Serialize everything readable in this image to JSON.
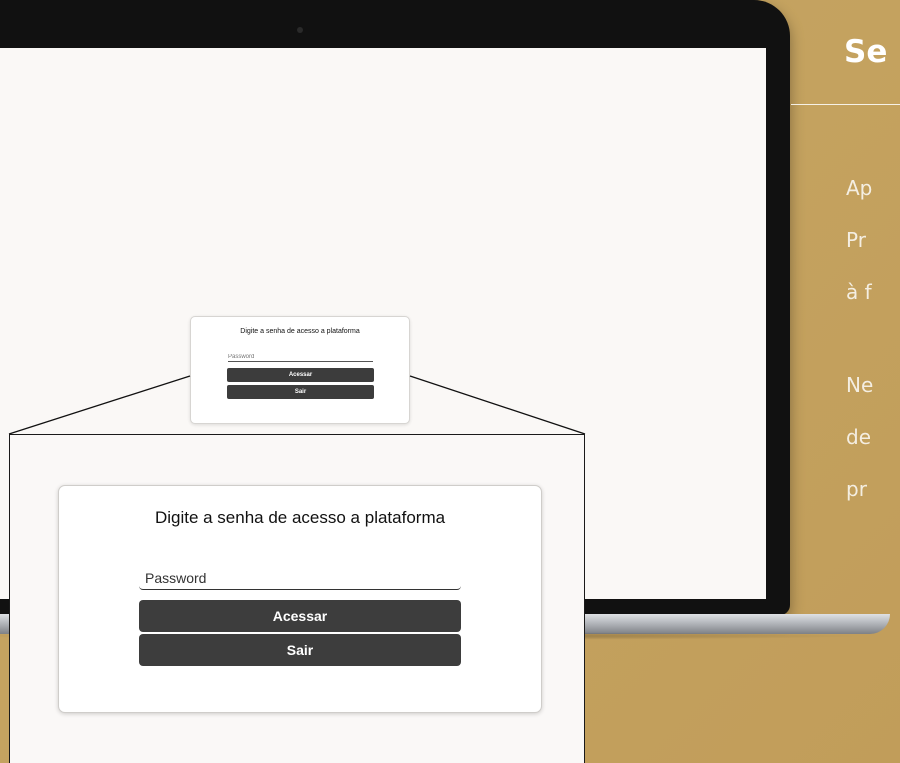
{
  "colors": {
    "background": "#c4a25f",
    "screen": "#faf8f6",
    "button": "#3d3d3d",
    "button_text": "#ffffff",
    "side_text": "#ffffff"
  },
  "side_panel": {
    "heading": "Se",
    "lines": [
      "Ap",
      "Pr",
      "à f",
      "Ne",
      "de",
      "pr"
    ]
  },
  "login_small": {
    "title": "Digite a senha de acesso a plataforma",
    "password_placeholder": "Password",
    "submit_label": "Acessar",
    "exit_label": "Sair"
  },
  "login_zoom": {
    "title": "Digite a senha de acesso a plataforma",
    "password_placeholder": "Password",
    "submit_label": "Acessar",
    "exit_label": "Sair"
  }
}
